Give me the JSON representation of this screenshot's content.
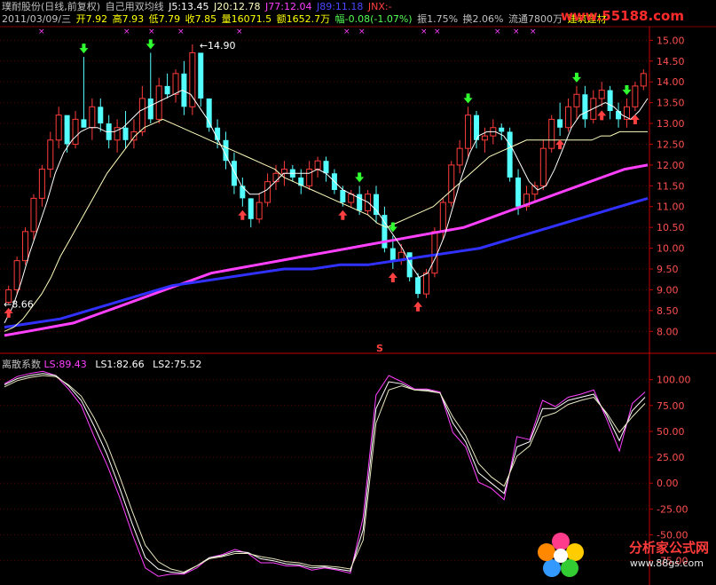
{
  "header": {
    "stock": "璞耐股份(日线,前复权)",
    "indicator": "自己用双均线",
    "j5": "J5:13.45",
    "j20": "J20:12.78",
    "j77": "J77:12.04",
    "j89": "J89:11.18",
    "jnx": "JNX:-",
    "date": "2011/03/09/三",
    "open": "开7.92",
    "high": "高7.93",
    "low": "低7.79",
    "close": "收7.85",
    "volume": "量16071.5",
    "amount": "额1652.7万",
    "change": "幅-0.08(-1.07%)",
    "amplitude": "振1.75%",
    "turnover": "换2.06%",
    "float": "流通7800万",
    "sector": "建筑建材"
  },
  "lower_header": {
    "name": "离散系数",
    "ls": "LS:89.43",
    "ls1": "LS1:82.66",
    "ls2": "LS2:75.52"
  },
  "watermarks": {
    "top": "www.55188.com",
    "bottom": "分析家公式网",
    "bottom_url": "www.88gs.com"
  },
  "annotations": {
    "high_label": "14.90",
    "low_label": "8.66",
    "s_marker": "S"
  },
  "colors": {
    "up": "#ff3c3c",
    "down": "#54ffff",
    "ma5": "#ffffff",
    "ma20": "#ffffc0",
    "ma77": "#ff40ff",
    "ma89": "#3030ff",
    "axis": "#c00000"
  },
  "chart_data": [
    {
      "type": "candlestick",
      "title": "",
      "ylim": [
        7.6,
        15.2
      ],
      "y_ticks": [
        "15.00",
        "14.50",
        "14.00",
        "13.50",
        "13.00",
        "12.50",
        "12.00",
        "11.50",
        "11.00",
        "10.50",
        "10.00",
        "9.50",
        "9.00",
        "8.50",
        "8.00"
      ],
      "candles": [
        [
          8.7,
          9.1,
          8.65,
          9.0
        ],
        [
          9.0,
          9.8,
          8.9,
          9.7
        ],
        [
          9.7,
          10.5,
          9.6,
          10.4
        ],
        [
          10.4,
          11.3,
          10.2,
          11.2
        ],
        [
          11.2,
          12.0,
          11.0,
          11.9
        ],
        [
          11.9,
          12.8,
          11.7,
          12.6
        ],
        [
          12.6,
          13.4,
          12.4,
          13.2
        ],
        [
          13.2,
          13.1,
          12.3,
          12.5
        ],
        [
          12.5,
          13.3,
          12.4,
          13.1
        ],
        [
          13.1,
          14.6,
          12.9,
          12.9
        ],
        [
          12.9,
          13.6,
          12.6,
          13.4
        ],
        [
          13.4,
          13.6,
          12.8,
          13.0
        ],
        [
          13.0,
          13.2,
          12.4,
          12.6
        ],
        [
          12.6,
          13.1,
          12.3,
          12.9
        ],
        [
          12.9,
          13.3,
          12.4,
          12.6
        ],
        [
          12.6,
          13.1,
          12.4,
          12.8
        ],
        [
          12.8,
          13.9,
          12.7,
          13.6
        ],
        [
          13.6,
          14.7,
          13.0,
          13.1
        ],
        [
          13.1,
          14.1,
          13.0,
          13.9
        ],
        [
          13.9,
          14.2,
          13.6,
          13.7
        ],
        [
          13.7,
          14.3,
          13.5,
          14.2
        ],
        [
          14.2,
          14.5,
          13.2,
          13.4
        ],
        [
          13.4,
          14.9,
          13.2,
          14.7
        ],
        [
          14.7,
          14.6,
          13.4,
          13.6
        ],
        [
          13.6,
          13.6,
          12.8,
          12.9
        ],
        [
          12.9,
          13.1,
          12.4,
          12.6
        ],
        [
          12.6,
          12.8,
          11.9,
          12.1
        ],
        [
          12.1,
          12.3,
          11.3,
          11.5
        ],
        [
          11.5,
          11.7,
          11.0,
          11.2
        ],
        [
          11.2,
          11.2,
          10.5,
          10.7
        ],
        [
          10.7,
          11.3,
          10.6,
          11.1
        ],
        [
          11.1,
          11.8,
          11.0,
          11.6
        ],
        [
          11.6,
          12.0,
          11.4,
          11.8
        ],
        [
          11.8,
          12.1,
          11.5,
          11.9
        ],
        [
          11.9,
          12.0,
          11.6,
          11.7
        ],
        [
          11.7,
          11.9,
          11.3,
          11.5
        ],
        [
          11.5,
          12.1,
          11.4,
          11.9
        ],
        [
          11.9,
          12.2,
          11.7,
          12.1
        ],
        [
          12.1,
          12.2,
          11.6,
          11.8
        ],
        [
          11.8,
          11.9,
          11.3,
          11.4
        ],
        [
          11.4,
          11.5,
          11.0,
          11.1
        ],
        [
          11.1,
          11.4,
          11.0,
          11.3
        ],
        [
          11.3,
          11.5,
          10.8,
          10.9
        ],
        [
          10.9,
          11.4,
          10.8,
          11.3
        ],
        [
          11.3,
          11.5,
          10.6,
          10.8
        ],
        [
          10.8,
          11.0,
          9.9,
          10.0
        ],
        [
          10.0,
          10.3,
          9.5,
          9.7
        ],
        [
          9.7,
          10.1,
          9.6,
          9.9
        ],
        [
          9.9,
          9.9,
          9.2,
          9.3
        ],
        [
          9.3,
          9.4,
          8.8,
          8.9
        ],
        [
          8.9,
          9.5,
          8.8,
          9.4
        ],
        [
          9.4,
          10.5,
          9.3,
          10.4
        ],
        [
          10.4,
          11.2,
          10.2,
          11.1
        ],
        [
          11.1,
          12.1,
          11.0,
          12.0
        ],
        [
          12.0,
          12.6,
          11.8,
          12.4
        ],
        [
          12.4,
          13.4,
          12.2,
          13.2
        ],
        [
          13.2,
          13.3,
          12.4,
          12.6
        ],
        [
          12.6,
          12.9,
          12.3,
          12.7
        ],
        [
          12.7,
          13.1,
          12.5,
          12.9
        ],
        [
          12.9,
          13.0,
          12.6,
          12.8
        ],
        [
          12.8,
          12.9,
          11.6,
          11.7
        ],
        [
          11.7,
          11.9,
          10.8,
          11.0
        ],
        [
          11.0,
          11.5,
          10.9,
          11.3
        ],
        [
          11.3,
          11.6,
          11.1,
          11.5
        ],
        [
          11.5,
          12.6,
          11.4,
          12.4
        ],
        [
          12.4,
          13.2,
          12.3,
          13.1
        ],
        [
          13.1,
          13.5,
          12.7,
          12.9
        ],
        [
          12.9,
          13.6,
          12.8,
          13.4
        ],
        [
          13.4,
          13.9,
          13.1,
          13.7
        ],
        [
          13.7,
          13.9,
          12.9,
          13.1
        ],
        [
          13.1,
          13.8,
          13.0,
          13.6
        ],
        [
          13.6,
          14.0,
          13.4,
          13.8
        ],
        [
          13.8,
          13.9,
          13.1,
          13.3
        ],
        [
          13.3,
          13.5,
          12.9,
          13.1
        ],
        [
          13.1,
          13.6,
          12.9,
          13.4
        ],
        [
          13.4,
          14.0,
          13.3,
          13.9
        ],
        [
          13.9,
          14.3,
          13.8,
          14.2
        ]
      ],
      "series": [
        {
          "name": "J5",
          "values": [
            8.2,
            8.6,
            9.2,
            9.9,
            10.5,
            11.1,
            11.8,
            12.3,
            12.6,
            12.8,
            12.9,
            12.9,
            12.8,
            12.8,
            12.9,
            13.1,
            13.3,
            13.4,
            13.5,
            13.6,
            13.7,
            13.8,
            13.7,
            13.4,
            13.1,
            12.7,
            12.3,
            11.9,
            11.5,
            11.3,
            11.3,
            11.4,
            11.6,
            11.8,
            11.8,
            11.8,
            11.8,
            11.9,
            11.8,
            11.6,
            11.4,
            11.3,
            11.2,
            11.1,
            10.9,
            10.6,
            10.3,
            10.0,
            9.6,
            9.3,
            9.4,
            9.8,
            10.3,
            11.0,
            11.7,
            12.3,
            12.7,
            12.8,
            12.8,
            12.7,
            12.4,
            12.0,
            11.6,
            11.4,
            11.5,
            11.9,
            12.4,
            12.9,
            13.2,
            13.3,
            13.4,
            13.5,
            13.4,
            13.2,
            13.1,
            13.3,
            13.6
          ]
        },
        {
          "name": "J20",
          "values": [
            8.0,
            8.1,
            8.3,
            8.6,
            8.9,
            9.3,
            9.8,
            10.2,
            10.6,
            11.0,
            11.4,
            11.8,
            12.1,
            12.4,
            12.7,
            12.9,
            13.0,
            13.1,
            13.0,
            12.9,
            12.8,
            12.7,
            12.6,
            12.5,
            12.4,
            12.3,
            12.2,
            12.1,
            12.0,
            11.9,
            11.7,
            11.6,
            11.5,
            11.4,
            11.3,
            11.2,
            11.1,
            11.0,
            10.9,
            10.8,
            10.6,
            10.5,
            10.6,
            10.7,
            10.8,
            10.9,
            11.0,
            11.2,
            11.4,
            11.6,
            11.8,
            12.0,
            12.2,
            12.3,
            12.4,
            12.5,
            12.6,
            12.6,
            12.6,
            12.6,
            12.6,
            12.6,
            12.6,
            12.6,
            12.7,
            12.7,
            12.8,
            12.8,
            12.8,
            12.8
          ]
        },
        {
          "name": "J77",
          "values": [
            7.9,
            8.0,
            8.1,
            8.2,
            8.4,
            8.6,
            8.8,
            9.0,
            9.2,
            9.4,
            9.5,
            9.6,
            9.7,
            9.8,
            9.9,
            10.0,
            10.1,
            10.2,
            10.3,
            10.4,
            10.5,
            10.7,
            10.9,
            11.1,
            11.3,
            11.5,
            11.7,
            11.9,
            12.0
          ]
        },
        {
          "name": "J89",
          "values": [
            8.1,
            8.2,
            8.3,
            8.5,
            8.7,
            8.9,
            9.1,
            9.2,
            9.3,
            9.4,
            9.5,
            9.5,
            9.6,
            9.6,
            9.7,
            9.8,
            9.9,
            10.0,
            10.2,
            10.4,
            10.6,
            10.8,
            11.0,
            11.2
          ]
        }
      ]
    },
    {
      "type": "line",
      "title": "",
      "ylim": [
        -95,
        110
      ],
      "y_ticks": [
        "100.00",
        "75.00",
        "50.00",
        "25.00",
        "0.00",
        "-25.00",
        "-50.00",
        "-75.00"
      ],
      "series": [
        {
          "name": "LS",
          "values": [
            96,
            103,
            106,
            108,
            104,
            91,
            75,
            45,
            18,
            -14,
            -50,
            -82,
            -90,
            -88,
            -88,
            -82,
            -72,
            -69,
            -64,
            -68,
            -77,
            -77,
            -80,
            -80,
            -84,
            -82,
            -84,
            -87,
            -33,
            85,
            104,
            98,
            91,
            91,
            88,
            49,
            35,
            1,
            -5,
            -16,
            45,
            42,
            80,
            74,
            83,
            86,
            90,
            62,
            31,
            77,
            88
          ]
        },
        {
          "name": "LS1",
          "values": [
            95,
            101,
            104,
            106,
            104,
            94,
            80,
            55,
            28,
            -5,
            -40,
            -72,
            -83,
            -86,
            -87,
            -80,
            -72,
            -70,
            -66,
            -67,
            -73,
            -75,
            -78,
            -79,
            -82,
            -81,
            -83,
            -85,
            -45,
            72,
            98,
            96,
            90,
            90,
            87,
            58,
            40,
            10,
            0,
            -10,
            35,
            40,
            72,
            72,
            80,
            83,
            86,
            66,
            41,
            70,
            83
          ]
        },
        {
          "name": "LS2",
          "values": [
            93,
            99,
            102,
            104,
            103,
            95,
            84,
            63,
            38,
            6,
            -28,
            -60,
            -76,
            -83,
            -86,
            -80,
            -73,
            -71,
            -68,
            -68,
            -71,
            -73,
            -76,
            -77,
            -80,
            -80,
            -81,
            -83,
            -55,
            58,
            90,
            94,
            90,
            89,
            87,
            64,
            46,
            19,
            6,
            -3,
            26,
            36,
            64,
            68,
            76,
            80,
            83,
            68,
            49,
            64,
            77
          ]
        }
      ]
    }
  ]
}
